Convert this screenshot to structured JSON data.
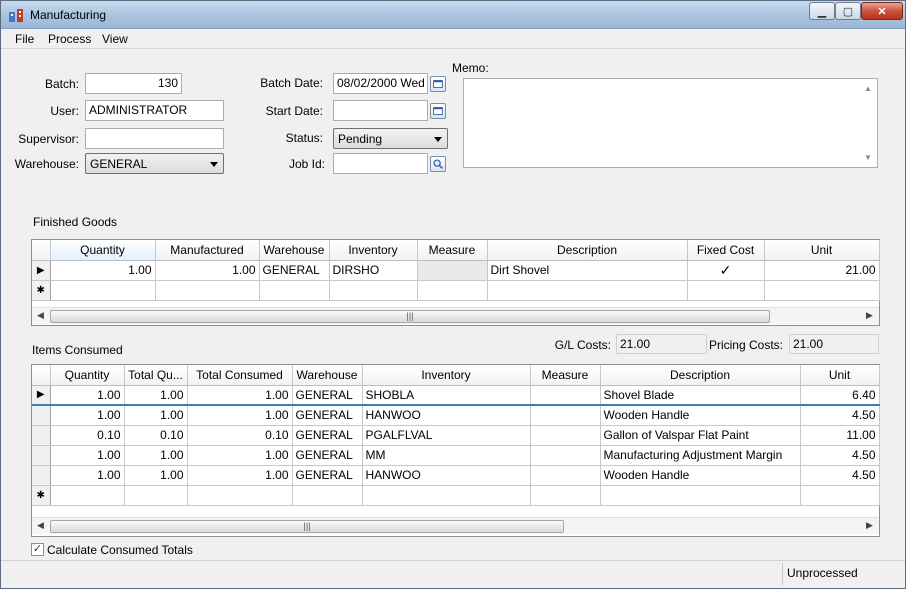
{
  "window": {
    "title": "Manufacturing"
  },
  "menu": [
    "File",
    "Process",
    "View"
  ],
  "form": {
    "batch_label": "Batch:",
    "batch_value": "130",
    "user_label": "User:",
    "user_value": "ADMINISTRATOR",
    "supervisor_label": "Supervisor:",
    "supervisor_value": "",
    "warehouse_label": "Warehouse:",
    "warehouse_value": "GENERAL",
    "batch_date_label": "Batch Date:",
    "batch_date_value": "08/02/2000 Wed",
    "start_date_label": "Start Date:",
    "start_date_value": "",
    "status_label": "Status:",
    "status_value": "Pending",
    "job_id_label": "Job Id:",
    "job_id_value": "",
    "memo_label": "Memo:",
    "memo_value": ""
  },
  "finished_goods": {
    "title": "Finished Goods",
    "columns": [
      "Quantity",
      "Manufactured",
      "Warehouse",
      "Inventory",
      "Measure",
      "Description",
      "Fixed Cost",
      "Unit"
    ],
    "rows": [
      {
        "quantity": "1.00",
        "manufactured": "1.00",
        "warehouse": "GENERAL",
        "inventory": "DIRSHO",
        "measure": "",
        "description": "Dirt Shovel",
        "fixed_cost": "✓",
        "unit": "21.00"
      }
    ],
    "new_row_marker": "✱",
    "current_row_marker": "▶"
  },
  "costs": {
    "gl_label": "G/L Costs:",
    "gl_value": "21.00",
    "pricing_label": "Pricing Costs:",
    "pricing_value": "21.00"
  },
  "items_consumed": {
    "title": "Items Consumed",
    "columns": [
      "Quantity",
      "Total Qu...",
      "Total Consumed",
      "Warehouse",
      "Inventory",
      "Measure",
      "Description",
      "Unit"
    ],
    "rows": [
      {
        "quantity": "1.00",
        "total_qu": "1.00",
        "total_consumed": "1.00",
        "warehouse": "GENERAL",
        "inventory": "SHOBLA",
        "measure": "",
        "description": "Shovel Blade",
        "unit": "6.40"
      },
      {
        "quantity": "1.00",
        "total_qu": "1.00",
        "total_consumed": "1.00",
        "warehouse": "GENERAL",
        "inventory": "HANWOO",
        "measure": "",
        "description": "Wooden Handle",
        "unit": "4.50"
      },
      {
        "quantity": "0.10",
        "total_qu": "0.10",
        "total_consumed": "0.10",
        "warehouse": "GENERAL",
        "inventory": "PGALFLVAL",
        "measure": "",
        "description": "Gallon of Valspar Flat Paint",
        "unit": "11.00"
      },
      {
        "quantity": "1.00",
        "total_qu": "1.00",
        "total_consumed": "1.00",
        "warehouse": "GENERAL",
        "inventory": "MM",
        "measure": "",
        "description": "Manufacturing Adjustment Margin",
        "unit": "4.50"
      },
      {
        "quantity": "1.00",
        "total_qu": "1.00",
        "total_consumed": "1.00",
        "warehouse": "GENERAL",
        "inventory": "HANWOO",
        "measure": "",
        "description": "Wooden Handle",
        "unit": "4.50"
      }
    ]
  },
  "checkbox": {
    "label": "Calculate Consumed Totals",
    "checked": true
  },
  "status_bar": {
    "text": "Unprocessed"
  },
  "icons": {
    "app": "manufacturing-app-icon",
    "calendar": "calendar-icon",
    "search": "magnifier-icon"
  },
  "colors": {
    "selected_row_line": "#3c7fb1",
    "title_gradient": "#a9c3de",
    "close": "#c9543f"
  }
}
